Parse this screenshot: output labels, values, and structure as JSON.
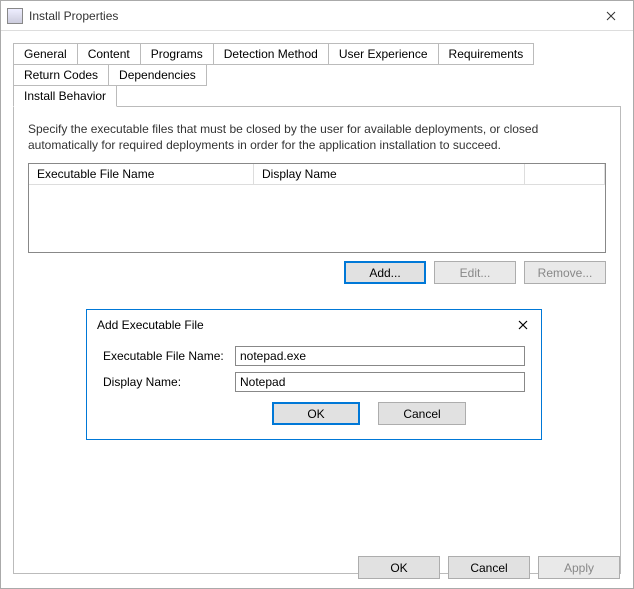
{
  "window": {
    "title": "Install Properties",
    "close_tooltip": "Close"
  },
  "tabs": {
    "row1": [
      "General",
      "Content",
      "Programs",
      "Detection Method",
      "User Experience",
      "Requirements",
      "Return Codes",
      "Dependencies"
    ],
    "row2": [
      "Install Behavior"
    ],
    "active": "Install Behavior"
  },
  "panel": {
    "description": "Specify the executable files that must be closed by the user for available deployments, or closed automatically for required deployments in order for the application installation to succeed.",
    "grid": {
      "columns": {
        "exe": "Executable File Name",
        "display": "Display Name"
      },
      "rows": []
    },
    "buttons": {
      "add": "Add...",
      "edit": "Edit...",
      "remove": "Remove..."
    }
  },
  "modal": {
    "title": "Add Executable File",
    "labels": {
      "exe": "Executable File Name:",
      "display": "Display Name:"
    },
    "values": {
      "exe": "notepad.exe",
      "display": "Notepad"
    },
    "buttons": {
      "ok": "OK",
      "cancel": "Cancel"
    }
  },
  "dialog_buttons": {
    "ok": "OK",
    "cancel": "Cancel",
    "apply": "Apply"
  }
}
